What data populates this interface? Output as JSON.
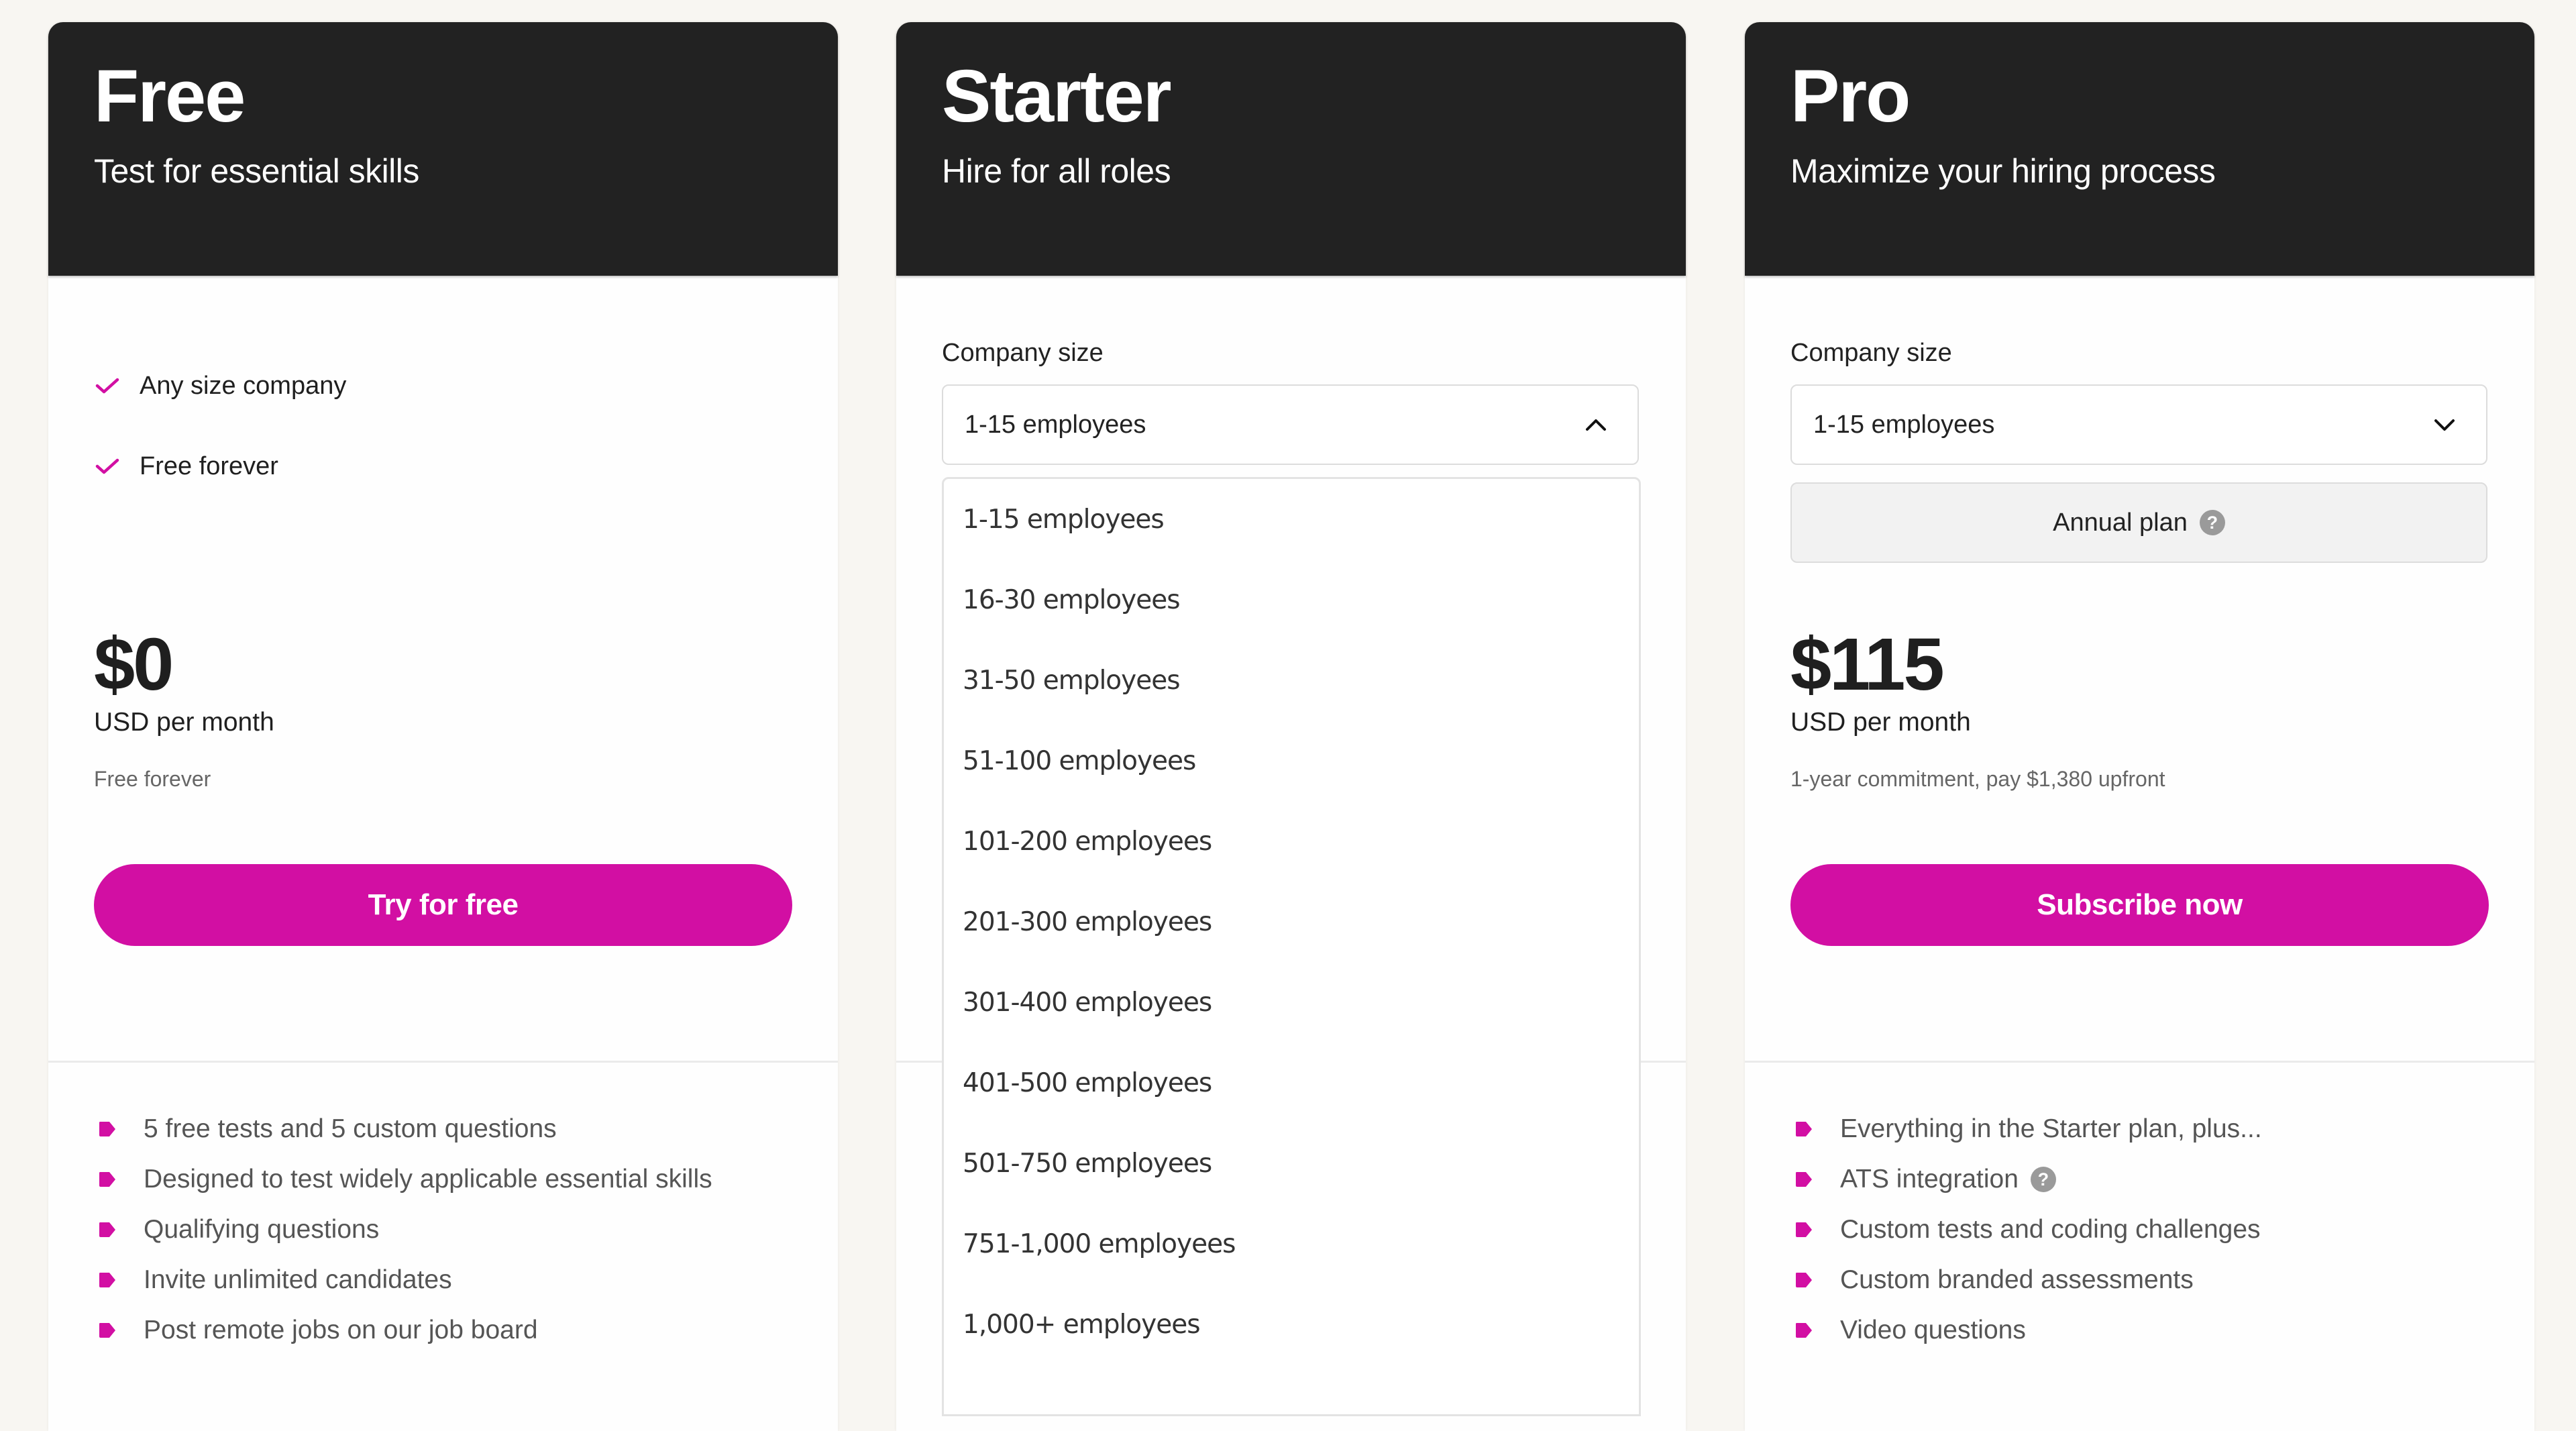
{
  "theme": {
    "accent": "#d20fa3",
    "header_bg": "#222222",
    "page_bg": "#f8f6f2"
  },
  "plans": {
    "free": {
      "title": "Free",
      "subtitle": "Test for essential skills",
      "highlights": [
        {
          "icon": "check-icon",
          "label": "Any size company"
        },
        {
          "icon": "check-icon",
          "label": "Free forever"
        }
      ],
      "price": "$0",
      "price_unit": "USD per month",
      "price_note": "Free forever",
      "cta_label": "Try for free",
      "features": [
        "5 free tests and 5 custom questions",
        "Designed to test widely applicable essential skills",
        "Qualifying questions",
        "Invite unlimited candidates",
        "Post remote jobs on our job board"
      ]
    },
    "starter": {
      "title": "Starter",
      "subtitle": "Hire for all roles",
      "company_size_label": "Company size",
      "company_size_value": "1-15 employees",
      "dropdown_open": true,
      "company_size_options": [
        "1-15 employees",
        "16-30 employees",
        "31-50 employees",
        "51-100 employees",
        "101-200 employees",
        "201-300 employees",
        "301-400 employees",
        "401-500 employees",
        "501-750 employees",
        "751-1,000 employees",
        "1,000+ employees"
      ]
    },
    "pro": {
      "title": "Pro",
      "subtitle": "Maximize your hiring process",
      "company_size_label": "Company size",
      "company_size_value": "1-15 employees",
      "billing_label": "Annual plan",
      "billing_help_icon": "help-icon",
      "price": "$115",
      "price_unit": "USD per month",
      "price_note": "1-year commitment, pay $1,380 upfront",
      "cta_label": "Subscribe now",
      "features": [
        {
          "label": "Everything in the Starter plan, plus...",
          "help": false
        },
        {
          "label": "ATS integration",
          "help": true
        },
        {
          "label": "Custom tests and coding challenges",
          "help": false
        },
        {
          "label": "Custom branded assessments",
          "help": false
        },
        {
          "label": "Video questions",
          "help": false
        }
      ],
      "help_glyph": "?"
    }
  }
}
